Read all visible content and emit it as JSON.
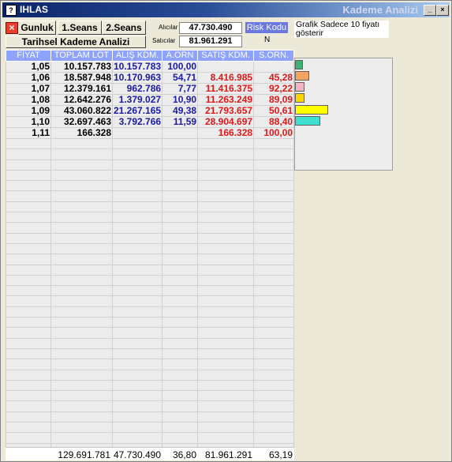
{
  "window": {
    "title": "IHLAS",
    "heading": "Kademe Analizi",
    "controls": {
      "minimize": "_",
      "maximize": "□",
      "close": "×"
    }
  },
  "toolbar": {
    "close_symbol": "×",
    "tabs": [
      "Gunluk",
      "1.Seans",
      "2.Seans"
    ],
    "historical_button": "Tarihsel Kademe Analizi"
  },
  "summary": {
    "buyers_label": "Alıcılar",
    "buyers_value": "47.730.490",
    "sellers_label": "Satıcılar",
    "sellers_value": "81.961.291",
    "risk_label": "Risk Kodu",
    "risk_value": "N",
    "note": "Grafik Sadece 10 fiyatı gösterir"
  },
  "table": {
    "columns": [
      "FİYAT",
      "TOPLAM LOT",
      "ALIŞ KDM.",
      "A.ORN",
      "SATIŞ KDM.",
      "S.ORN."
    ],
    "rows": [
      {
        "fiyat": "1,05",
        "toplam": "10.157.783",
        "alis": "10.157.783",
        "aorn": "100,00",
        "satis": "",
        "sorn": ""
      },
      {
        "fiyat": "1,06",
        "toplam": "18.587.948",
        "alis": "10.170.963",
        "aorn": "54,71",
        "satis": "8.416.985",
        "sorn": "45,28"
      },
      {
        "fiyat": "1,07",
        "toplam": "12.379.161",
        "alis": "962.786",
        "aorn": "7,77",
        "satis": "11.416.375",
        "sorn": "92,22"
      },
      {
        "fiyat": "1,08",
        "toplam": "12.642.276",
        "alis": "1.379.027",
        "aorn": "10,90",
        "satis": "11.263.249",
        "sorn": "89,09"
      },
      {
        "fiyat": "1,09",
        "toplam": "43.060.822",
        "alis": "21.267.165",
        "aorn": "49,38",
        "satis": "21.793.657",
        "sorn": "50,61"
      },
      {
        "fiyat": "1,10",
        "toplam": "32.697.463",
        "alis": "3.792.766",
        "aorn": "11,59",
        "satis": "28.904.697",
        "sorn": "88,40"
      },
      {
        "fiyat": "1,11",
        "toplam": "166.328",
        "alis": "",
        "aorn": "",
        "satis": "166.328",
        "sorn": "100,00"
      }
    ],
    "totals": {
      "toplam": "129.691.781",
      "alis": "47.730.490",
      "aorn": "36,80",
      "satis": "81.961.291",
      "sorn": "63,19"
    }
  },
  "chart_data": {
    "type": "bar",
    "categories": [
      "1,05",
      "1,06",
      "1,07",
      "1,08",
      "1,09",
      "1,10",
      "1,11"
    ],
    "values": [
      10157783,
      18587948,
      12379161,
      12642276,
      43060822,
      32697463,
      166328
    ],
    "colors": [
      "#3cb371",
      "#f4a460",
      "#f4b6c2",
      "#ffd700",
      "#ffff00",
      "#40e0d0",
      "#ececec"
    ]
  }
}
